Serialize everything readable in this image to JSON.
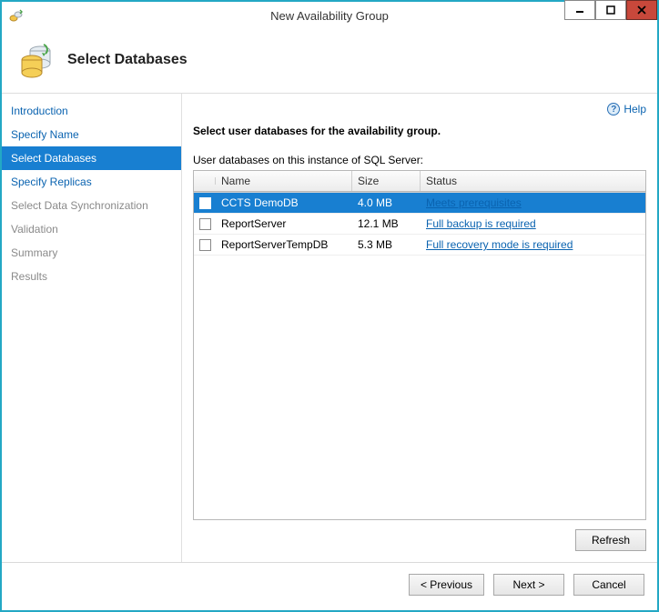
{
  "window": {
    "title": "New Availability Group"
  },
  "page": {
    "heading": "Select Databases",
    "help": "Help",
    "instruction": "Select user databases for the availability group.",
    "list_label": "User databases on this instance of SQL Server:"
  },
  "sidebar": {
    "items": [
      {
        "label": "Introduction",
        "state": "link"
      },
      {
        "label": "Specify Name",
        "state": "link"
      },
      {
        "label": "Select Databases",
        "state": "selected"
      },
      {
        "label": "Specify Replicas",
        "state": "link"
      },
      {
        "label": "Select Data Synchronization",
        "state": "disabled"
      },
      {
        "label": "Validation",
        "state": "disabled"
      },
      {
        "label": "Summary",
        "state": "disabled"
      },
      {
        "label": "Results",
        "state": "disabled"
      }
    ]
  },
  "grid": {
    "columns": {
      "name": "Name",
      "size": "Size",
      "status": "Status"
    },
    "rows": [
      {
        "checked": true,
        "selected": true,
        "name": "CCTS DemoDB",
        "size": "4.0 MB",
        "status": "Meets prerequisites"
      },
      {
        "checked": false,
        "selected": false,
        "name": "ReportServer",
        "size": "12.1 MB",
        "status": "Full backup is required"
      },
      {
        "checked": false,
        "selected": false,
        "name": "ReportServerTempDB",
        "size": "5.3 MB",
        "status": "Full recovery mode is required"
      }
    ]
  },
  "buttons": {
    "refresh": "Refresh",
    "previous": "< Previous",
    "next": "Next >",
    "cancel": "Cancel"
  }
}
